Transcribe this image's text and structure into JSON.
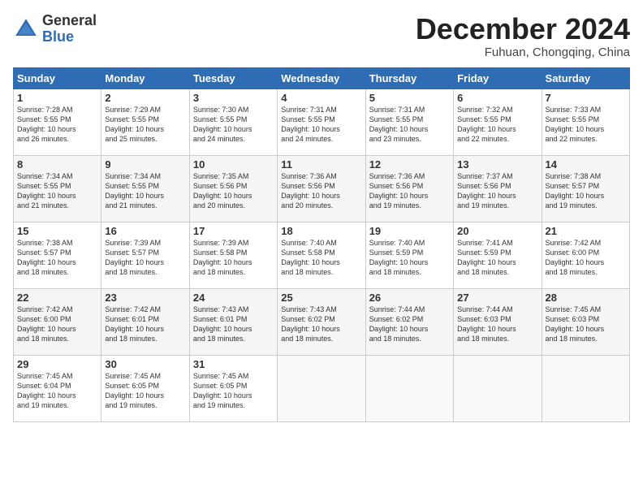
{
  "logo": {
    "general": "General",
    "blue": "Blue"
  },
  "header": {
    "month": "December 2024",
    "location": "Fuhuan, Chongqing, China"
  },
  "weekdays": [
    "Sunday",
    "Monday",
    "Tuesday",
    "Wednesday",
    "Thursday",
    "Friday",
    "Saturday"
  ],
  "weeks": [
    [
      {
        "day": "1",
        "info": "Sunrise: 7:28 AM\nSunset: 5:55 PM\nDaylight: 10 hours\nand 26 minutes."
      },
      {
        "day": "2",
        "info": "Sunrise: 7:29 AM\nSunset: 5:55 PM\nDaylight: 10 hours\nand 25 minutes."
      },
      {
        "day": "3",
        "info": "Sunrise: 7:30 AM\nSunset: 5:55 PM\nDaylight: 10 hours\nand 24 minutes."
      },
      {
        "day": "4",
        "info": "Sunrise: 7:31 AM\nSunset: 5:55 PM\nDaylight: 10 hours\nand 24 minutes."
      },
      {
        "day": "5",
        "info": "Sunrise: 7:31 AM\nSunset: 5:55 PM\nDaylight: 10 hours\nand 23 minutes."
      },
      {
        "day": "6",
        "info": "Sunrise: 7:32 AM\nSunset: 5:55 PM\nDaylight: 10 hours\nand 22 minutes."
      },
      {
        "day": "7",
        "info": "Sunrise: 7:33 AM\nSunset: 5:55 PM\nDaylight: 10 hours\nand 22 minutes."
      }
    ],
    [
      {
        "day": "8",
        "info": "Sunrise: 7:34 AM\nSunset: 5:55 PM\nDaylight: 10 hours\nand 21 minutes."
      },
      {
        "day": "9",
        "info": "Sunrise: 7:34 AM\nSunset: 5:55 PM\nDaylight: 10 hours\nand 21 minutes."
      },
      {
        "day": "10",
        "info": "Sunrise: 7:35 AM\nSunset: 5:56 PM\nDaylight: 10 hours\nand 20 minutes."
      },
      {
        "day": "11",
        "info": "Sunrise: 7:36 AM\nSunset: 5:56 PM\nDaylight: 10 hours\nand 20 minutes."
      },
      {
        "day": "12",
        "info": "Sunrise: 7:36 AM\nSunset: 5:56 PM\nDaylight: 10 hours\nand 19 minutes."
      },
      {
        "day": "13",
        "info": "Sunrise: 7:37 AM\nSunset: 5:56 PM\nDaylight: 10 hours\nand 19 minutes."
      },
      {
        "day": "14",
        "info": "Sunrise: 7:38 AM\nSunset: 5:57 PM\nDaylight: 10 hours\nand 19 minutes."
      }
    ],
    [
      {
        "day": "15",
        "info": "Sunrise: 7:38 AM\nSunset: 5:57 PM\nDaylight: 10 hours\nand 18 minutes."
      },
      {
        "day": "16",
        "info": "Sunrise: 7:39 AM\nSunset: 5:57 PM\nDaylight: 10 hours\nand 18 minutes."
      },
      {
        "day": "17",
        "info": "Sunrise: 7:39 AM\nSunset: 5:58 PM\nDaylight: 10 hours\nand 18 minutes."
      },
      {
        "day": "18",
        "info": "Sunrise: 7:40 AM\nSunset: 5:58 PM\nDaylight: 10 hours\nand 18 minutes."
      },
      {
        "day": "19",
        "info": "Sunrise: 7:40 AM\nSunset: 5:59 PM\nDaylight: 10 hours\nand 18 minutes."
      },
      {
        "day": "20",
        "info": "Sunrise: 7:41 AM\nSunset: 5:59 PM\nDaylight: 10 hours\nand 18 minutes."
      },
      {
        "day": "21",
        "info": "Sunrise: 7:42 AM\nSunset: 6:00 PM\nDaylight: 10 hours\nand 18 minutes."
      }
    ],
    [
      {
        "day": "22",
        "info": "Sunrise: 7:42 AM\nSunset: 6:00 PM\nDaylight: 10 hours\nand 18 minutes."
      },
      {
        "day": "23",
        "info": "Sunrise: 7:42 AM\nSunset: 6:01 PM\nDaylight: 10 hours\nand 18 minutes."
      },
      {
        "day": "24",
        "info": "Sunrise: 7:43 AM\nSunset: 6:01 PM\nDaylight: 10 hours\nand 18 minutes."
      },
      {
        "day": "25",
        "info": "Sunrise: 7:43 AM\nSunset: 6:02 PM\nDaylight: 10 hours\nand 18 minutes."
      },
      {
        "day": "26",
        "info": "Sunrise: 7:44 AM\nSunset: 6:02 PM\nDaylight: 10 hours\nand 18 minutes."
      },
      {
        "day": "27",
        "info": "Sunrise: 7:44 AM\nSunset: 6:03 PM\nDaylight: 10 hours\nand 18 minutes."
      },
      {
        "day": "28",
        "info": "Sunrise: 7:45 AM\nSunset: 6:03 PM\nDaylight: 10 hours\nand 18 minutes."
      }
    ],
    [
      {
        "day": "29",
        "info": "Sunrise: 7:45 AM\nSunset: 6:04 PM\nDaylight: 10 hours\nand 19 minutes."
      },
      {
        "day": "30",
        "info": "Sunrise: 7:45 AM\nSunset: 6:05 PM\nDaylight: 10 hours\nand 19 minutes."
      },
      {
        "day": "31",
        "info": "Sunrise: 7:45 AM\nSunset: 6:05 PM\nDaylight: 10 hours\nand 19 minutes."
      },
      {
        "day": "",
        "info": ""
      },
      {
        "day": "",
        "info": ""
      },
      {
        "day": "",
        "info": ""
      },
      {
        "day": "",
        "info": ""
      }
    ]
  ]
}
